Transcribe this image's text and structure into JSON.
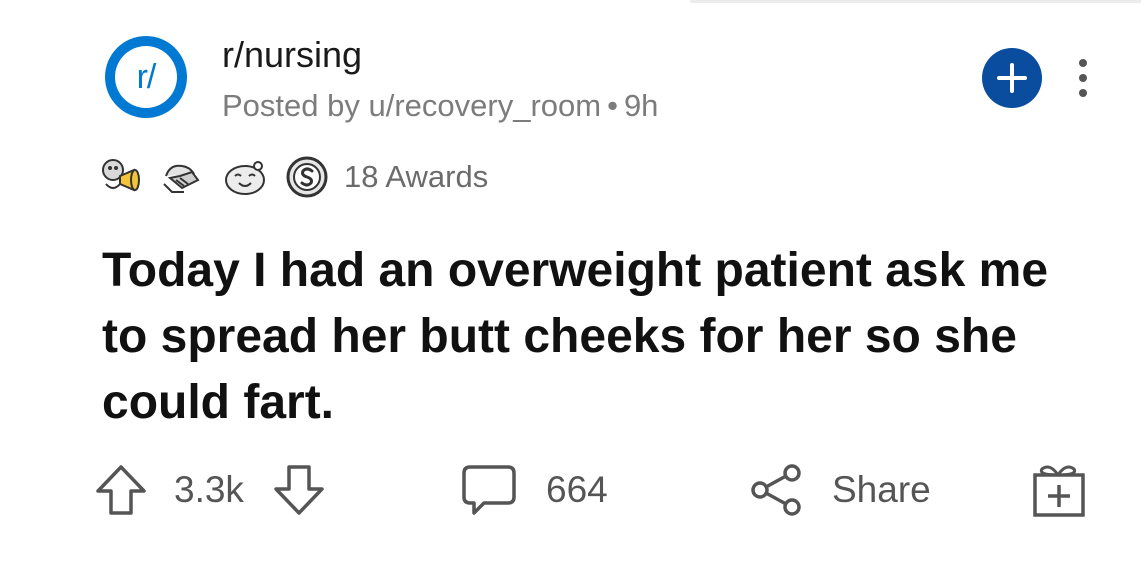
{
  "post": {
    "subreddit": "r/nursing",
    "avatar_text": "r/",
    "posted_by": "Posted by u/recovery_room",
    "separator": "•",
    "age": "9h",
    "awards_label": "18 Awards",
    "title": "Today I had an overweight patient ask me to spread her butt cheeks for her so she could fart."
  },
  "actions": {
    "score": "3.3k",
    "comments": "664",
    "share_label": "Share"
  },
  "icons": {
    "join": "plus-icon",
    "more": "more-vertical-icon",
    "upvote": "arrow-up-icon",
    "downvote": "arrow-down-icon",
    "comments": "speech-bubble-icon",
    "share": "share-nodes-icon",
    "gift": "gift-plus-icon"
  },
  "colors": {
    "brand_blue": "#0079d3",
    "join_button": "#0a4d9e",
    "meta_gray": "#7c7c7c",
    "action_gray": "#555555"
  }
}
